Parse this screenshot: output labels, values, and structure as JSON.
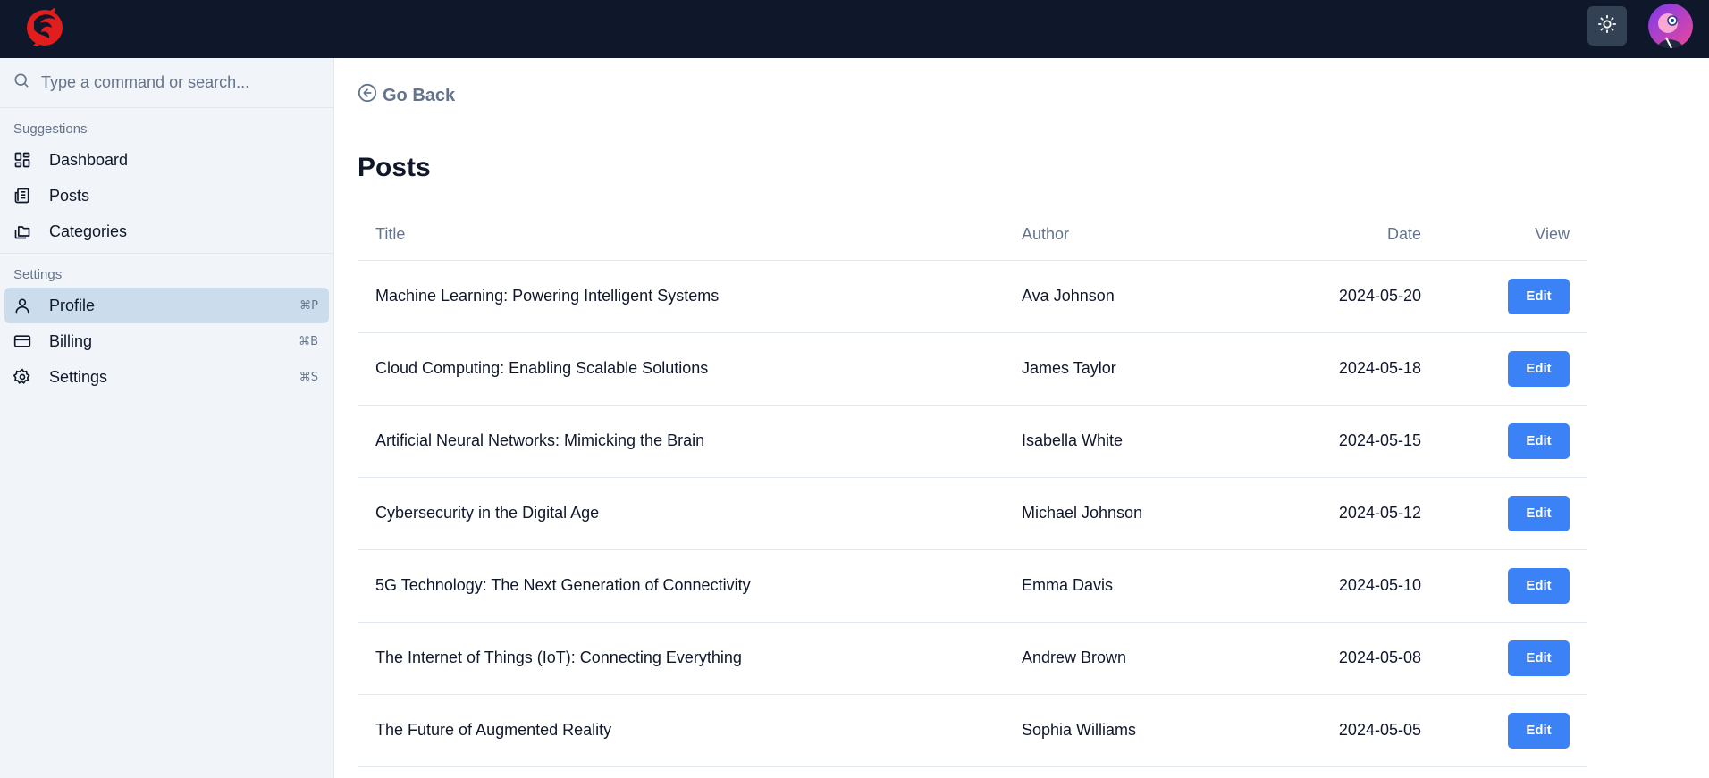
{
  "header": {
    "logo_icon": "phoenix-logo-icon",
    "theme_toggle_icon": "sun-icon",
    "avatar_icon": "user-avatar"
  },
  "sidebar": {
    "search": {
      "placeholder": "Type a command or search..."
    },
    "groups": [
      {
        "label": "Suggestions",
        "items": [
          {
            "label": "Dashboard",
            "icon": "dashboard-icon"
          },
          {
            "label": "Posts",
            "icon": "newspaper-icon"
          },
          {
            "label": "Categories",
            "icon": "folders-icon"
          }
        ]
      },
      {
        "label": "Settings",
        "items": [
          {
            "label": "Profile",
            "icon": "user-icon",
            "shortcut": "⌘P",
            "active": true
          },
          {
            "label": "Billing",
            "icon": "credit-card-icon",
            "shortcut": "⌘B"
          },
          {
            "label": "Settings",
            "icon": "gear-icon",
            "shortcut": "⌘S"
          }
        ]
      }
    ]
  },
  "main": {
    "go_back_label": "Go Back",
    "page_title": "Posts",
    "table": {
      "columns": [
        "Title",
        "Author",
        "Date",
        "View"
      ],
      "rows": [
        {
          "title": "Machine Learning: Powering Intelligent Systems",
          "author": "Ava Johnson",
          "date": "2024-05-20",
          "action": "Edit"
        },
        {
          "title": "Cloud Computing: Enabling Scalable Solutions",
          "author": "James Taylor",
          "date": "2024-05-18",
          "action": "Edit"
        },
        {
          "title": "Artificial Neural Networks: Mimicking the Brain",
          "author": "Isabella White",
          "date": "2024-05-15",
          "action": "Edit"
        },
        {
          "title": "Cybersecurity in the Digital Age",
          "author": "Michael Johnson",
          "date": "2024-05-12",
          "action": "Edit"
        },
        {
          "title": "5G Technology: The Next Generation of Connectivity",
          "author": "Emma Davis",
          "date": "2024-05-10",
          "action": "Edit"
        },
        {
          "title": "The Internet of Things (IoT): Connecting Everything",
          "author": "Andrew Brown",
          "date": "2024-05-08",
          "action": "Edit"
        },
        {
          "title": "The Future of Augmented Reality",
          "author": "Sophia Williams",
          "date": "2024-05-05",
          "action": "Edit"
        }
      ]
    }
  },
  "colors": {
    "topbar": "#0f172a",
    "sidebar_bg": "#f1f5f9",
    "active_item": "#cbdcec",
    "accent": "#3b82f6",
    "muted_text": "#64748b"
  }
}
